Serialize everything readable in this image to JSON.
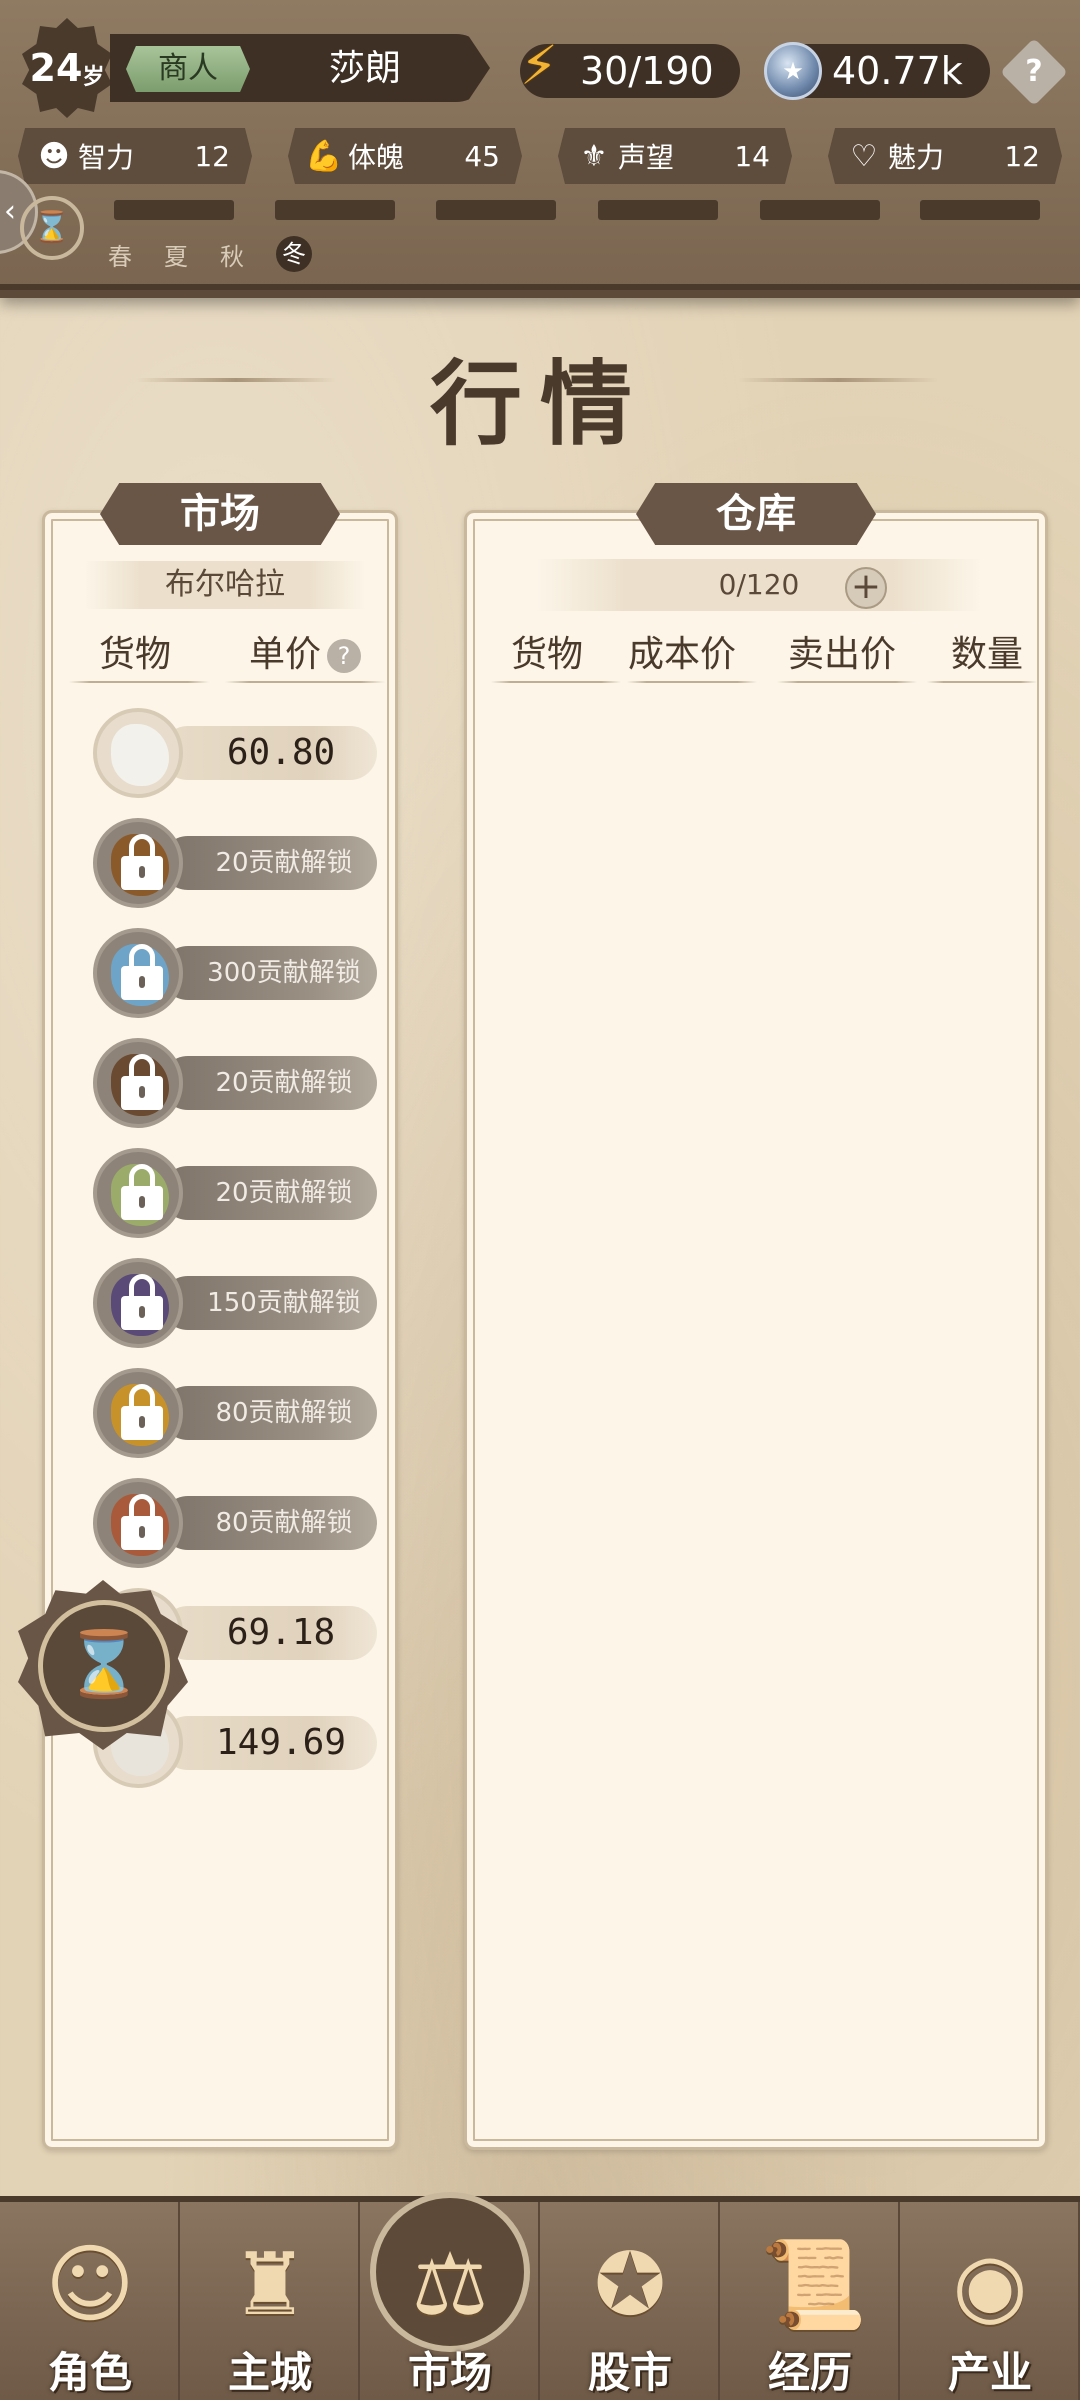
{
  "header": {
    "age": "24",
    "age_unit": "岁",
    "profession": "商人",
    "player_name": "莎朗",
    "energy": "30/190",
    "coins": "40.77k",
    "help": "?",
    "stats": [
      {
        "icon": "brain-icon",
        "label": "智力",
        "value": "12"
      },
      {
        "icon": "muscle-icon",
        "label": "体魄",
        "value": "45"
      },
      {
        "icon": "reputation-icon",
        "label": "声望",
        "value": "14"
      },
      {
        "icon": "heart-icon",
        "label": "魅力",
        "value": "12"
      }
    ],
    "seasons": [
      "春",
      "夏",
      "秋",
      "冬"
    ],
    "current_season": "冬"
  },
  "title": "行情",
  "market": {
    "tab_label": "市场",
    "city": "布尔哈拉",
    "col_goods": "货物",
    "col_price": "单价",
    "goods": [
      {
        "price": "60.80",
        "locked": false,
        "unlock": "",
        "color": "#f3f1ec"
      },
      {
        "price": "",
        "locked": true,
        "unlock": "20贡献解锁",
        "color": "#8a5a2a"
      },
      {
        "price": "",
        "locked": true,
        "unlock": "300贡献解锁",
        "color": "#6ea4c8"
      },
      {
        "price": "",
        "locked": true,
        "unlock": "20贡献解锁",
        "color": "#6a4a30"
      },
      {
        "price": "",
        "locked": true,
        "unlock": "20贡献解锁",
        "color": "#9aab6a"
      },
      {
        "price": "",
        "locked": true,
        "unlock": "150贡献解锁",
        "color": "#5a4a78"
      },
      {
        "price": "",
        "locked": true,
        "unlock": "80贡献解锁",
        "color": "#c8922a"
      },
      {
        "price": "",
        "locked": true,
        "unlock": "80贡献解锁",
        "color": "#a85a3a"
      },
      {
        "price": "69.18",
        "locked": false,
        "unlock": "",
        "color": "#9a948c"
      },
      {
        "price": "149.69",
        "locked": false,
        "unlock": "",
        "color": "#e8e4dc"
      }
    ]
  },
  "warehouse": {
    "tab_label": "仓库",
    "capacity": "0/120",
    "add": "+",
    "columns": [
      "货物",
      "成本价",
      "卖出价",
      "数量"
    ]
  },
  "nav": [
    {
      "label": "角色",
      "icon": "character-icon",
      "active": false
    },
    {
      "label": "主城",
      "icon": "castle-icon",
      "active": false
    },
    {
      "label": "市场",
      "icon": "scales-icon",
      "active": true
    },
    {
      "label": "股市",
      "icon": "stock-icon",
      "active": false
    },
    {
      "label": "经历",
      "icon": "scroll-icon",
      "active": false
    },
    {
      "label": "产业",
      "icon": "coins-icon",
      "active": false
    }
  ]
}
